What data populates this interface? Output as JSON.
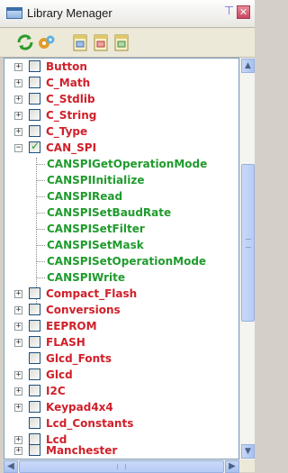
{
  "window": {
    "title": "Library Menager"
  },
  "toolbar": {
    "buttons": [
      {
        "name": "refresh",
        "icon": "refresh-icon"
      },
      {
        "name": "settings",
        "icon": "gear-icon"
      },
      {
        "name": "doc1",
        "icon": "document-icon"
      },
      {
        "name": "doc2",
        "icon": "document-icon"
      },
      {
        "name": "doc3",
        "icon": "document-icon"
      }
    ]
  },
  "tree": {
    "items": [
      {
        "label": "Button",
        "expander": "+",
        "checked": false,
        "color": "#d0202a"
      },
      {
        "label": "C_Math",
        "expander": "+",
        "checked": false,
        "color": "#d0202a"
      },
      {
        "label": "C_Stdlib",
        "expander": "+",
        "checked": false,
        "color": "#d0202a"
      },
      {
        "label": "C_String",
        "expander": "+",
        "checked": false,
        "color": "#d0202a"
      },
      {
        "label": "C_Type",
        "expander": "+",
        "checked": false,
        "color": "#d0202a"
      },
      {
        "label": "CAN_SPI",
        "expander": "−",
        "checked": true,
        "color": "#d0202a",
        "children": [
          "CANSPIGetOperationMode",
          "CANSPIInitialize",
          "CANSPIRead",
          "CANSPISetBaudRate",
          "CANSPISetFilter",
          "CANSPISetMask",
          "CANSPISetOperationMode",
          "CANSPIWrite"
        ],
        "child_color": "#1f9b2d"
      },
      {
        "label": "Compact_Flash",
        "expander": "+",
        "checked": false,
        "color": "#d0202a"
      },
      {
        "label": "Conversions",
        "expander": "+",
        "checked": false,
        "color": "#d0202a"
      },
      {
        "label": "EEPROM",
        "expander": "+",
        "checked": false,
        "color": "#d0202a"
      },
      {
        "label": "FLASH",
        "expander": "+",
        "checked": false,
        "color": "#d0202a"
      },
      {
        "label": "Glcd_Fonts",
        "expander": "",
        "checked": false,
        "color": "#d0202a"
      },
      {
        "label": "Glcd",
        "expander": "+",
        "checked": false,
        "color": "#d0202a"
      },
      {
        "label": "I2C",
        "expander": "+",
        "checked": false,
        "color": "#d0202a"
      },
      {
        "label": "Keypad4x4",
        "expander": "+",
        "checked": false,
        "color": "#d0202a"
      },
      {
        "label": "Lcd_Constants",
        "expander": "",
        "checked": false,
        "color": "#d0202a"
      },
      {
        "label": "Lcd",
        "expander": "+",
        "checked": false,
        "color": "#d0202a"
      },
      {
        "label": "Manchester",
        "expander": "+",
        "checked": false,
        "color": "#d0202a"
      }
    ]
  },
  "scrollbars": {
    "vertical": {
      "up_arrow": "▲",
      "down_arrow": "▼"
    },
    "horizontal": {
      "left_arrow": "◀",
      "right_arrow": "▶"
    }
  }
}
